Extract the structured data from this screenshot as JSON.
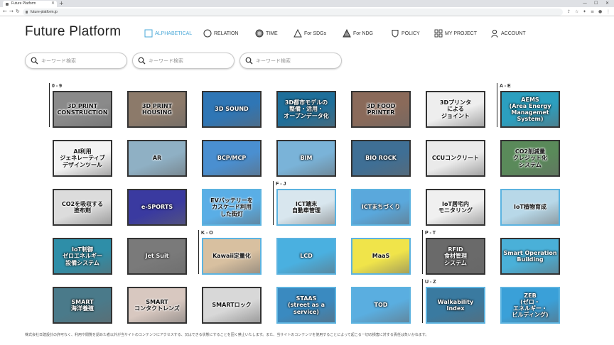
{
  "browser": {
    "tab_title": "Future Platform",
    "url": "future-platform.jp"
  },
  "header": {
    "logo": "Future Platform",
    "nav": [
      {
        "label": "ALPHABETICAL",
        "icon": "square-icon",
        "active": true
      },
      {
        "label": "RELATION",
        "icon": "circle-icon"
      },
      {
        "label": "TIME",
        "icon": "clock-icon"
      },
      {
        "label": "For SDGs",
        "icon": "triangle-outline-icon"
      },
      {
        "label": "For NDG",
        "icon": "triangle-striped-icon"
      },
      {
        "label": "POLICY",
        "icon": "shield-icon"
      },
      {
        "label": "MY PROJECT",
        "icon": "grid-icon"
      },
      {
        "label": "ACCOUNT",
        "icon": "user-icon"
      }
    ]
  },
  "search": {
    "placeholder": "キーワード検索"
  },
  "sections": {
    "s09": "0 - 9",
    "sae": "A - E",
    "sfj": "F - J",
    "sko": "K - O",
    "spt": "P - T",
    "suz": "U - Z"
  },
  "tiles": [
    {
      "label": "3D PRINT\nCONSTRUCTION",
      "bg": "#8a8a8a",
      "tone": "dark"
    },
    {
      "label": "3D PRINT\nHOUSING",
      "bg": "#8c7a6a",
      "tone": "dark"
    },
    {
      "label": "3D SOUND",
      "bg": "#2f76b5",
      "tone": "light"
    },
    {
      "label": "3D都市モデルの\n整備・活用・\nオープンデータ化",
      "bg": "#1f6f9a",
      "tone": "light"
    },
    {
      "label": "3D FOOD\nPRINTER",
      "bg": "#8a6a5a",
      "tone": "dark"
    },
    {
      "label": "3Dプリンタ\nによる\nジョイント",
      "bg": "#eeeeee",
      "tone": "dark"
    },
    {
      "label": "AEMS\n(Area Energy\nManagemet\nSystem)",
      "bg": "#2c9fbf",
      "tone": "light"
    },
    {
      "label": "AI利用\nジェネレーティブ\nデザインツール",
      "bg": "#f2f2f2",
      "tone": "dark"
    },
    {
      "label": "AR",
      "bg": "#8fb0c4",
      "tone": "dark"
    },
    {
      "label": "BCP/MCP",
      "bg": "#4a8fd0",
      "tone": "light"
    },
    {
      "label": "BIM",
      "bg": "#7ab3d8",
      "tone": "light"
    },
    {
      "label": "BIO ROCK",
      "bg": "#3f6f95",
      "tone": "light"
    },
    {
      "label": "CCUコンクリート",
      "bg": "#eaeaea",
      "tone": "dark"
    },
    {
      "label": "CO2削減量\nクレジット化\nシステム",
      "bg": "#5a8a5a",
      "tone": "dark"
    },
    {
      "label": "CO2を吸収する\n塗布剤",
      "bg": "#dcdcdc",
      "tone": "dark"
    },
    {
      "label": "e-SPORTS",
      "bg": "#3a3aa0",
      "tone": "light"
    },
    {
      "label": "EVバッテリーを\nカスケード利用\nした街灯",
      "bg": "#5aaee6",
      "tone": "dark"
    },
    {
      "label": "ICT端末\n自動車管理",
      "bg": "#d8e6ee",
      "tone": "dark"
    },
    {
      "label": "ICTまちづくり",
      "bg": "#5aa8dc",
      "tone": "light"
    },
    {
      "label": "IoT居宅内\nモニタリング",
      "bg": "#f0f0f0",
      "tone": "dark"
    },
    {
      "label": "IoT植物育成",
      "bg": "#b8d8e8",
      "tone": "dark"
    },
    {
      "label": "IoT制御\nゼロエネルギー\n設備システム",
      "bg": "#2e8ea8",
      "tone": "light"
    },
    {
      "label": "Jet Suit",
      "bg": "#7a7a7a",
      "tone": "light"
    },
    {
      "label": "Kawaii定量化",
      "bg": "#d8c0a0",
      "tone": "dark"
    },
    {
      "label": "LCD",
      "bg": "#4ab0e0",
      "tone": "light"
    },
    {
      "label": "MaaS",
      "bg": "#f0e44a",
      "tone": "dark"
    },
    {
      "label": "RFID\n食材管理\nシステム",
      "bg": "#6a6a6a",
      "tone": "light"
    },
    {
      "label": "Smart Operation\nBuilding",
      "bg": "#4ab0d8",
      "tone": "light"
    },
    {
      "label": "SMART\n海洋養殖",
      "bg": "#4a7a8a",
      "tone": "light"
    },
    {
      "label": "SMART\nコンタクトレンズ",
      "bg": "#d8c8c0",
      "tone": "dark"
    },
    {
      "label": "SMARTロック",
      "bg": "#d8d8d8",
      "tone": "dark"
    },
    {
      "label": "STAAS\n(street as a\nservice)",
      "bg": "#3a8ac0",
      "tone": "light"
    },
    {
      "label": "TOD",
      "bg": "#5aaee0",
      "tone": "light"
    },
    {
      "label": "Walkability\nIndex",
      "bg": "#3a7aa0",
      "tone": "light"
    },
    {
      "label": "ZEB\n(ゼロ・\nエネルギー・\nビルディング)",
      "bg": "#3aa0d8",
      "tone": "light"
    }
  ],
  "footer": "株式会社日建設計の許可なく、利用や閲覧を認めた者以外が当サイトのコンテンツにアクセスする、又はできる状態にすることを固く禁止いたします。また、当サイトのコンテンツを使用することによって起こる一切の損害に対する責任は負いかねます。"
}
